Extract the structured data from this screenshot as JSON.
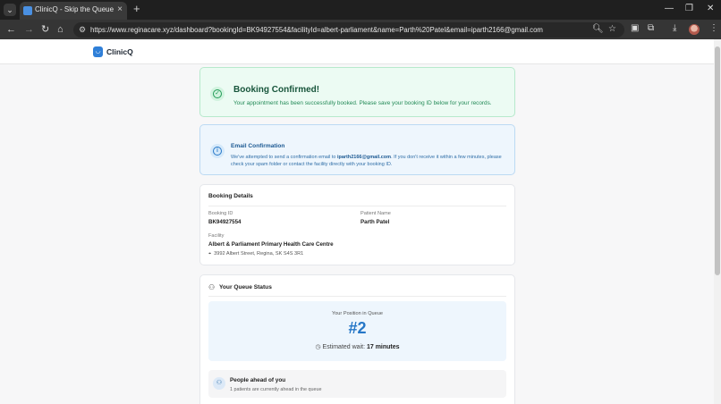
{
  "browser": {
    "tab_title": "ClinicQ - Skip the Queue",
    "url": "https://www.reginacare.xyz/dashboard?bookingId=BK94927554&facilityId=albert-parliament&name=Parth%20Patel&email=iparth2166@gmail.com"
  },
  "app": {
    "logo_text": "ClinicQ"
  },
  "confirmation": {
    "title": "Booking Confirmed!",
    "message": "Your appointment has been successfully booked. Please save your booking ID below for your records."
  },
  "email_notice": {
    "title": "Email Confirmation",
    "text_before": "We've attempted to send a confirmation email to ",
    "email": "iparth2166@gmail.com",
    "text_after": ". If you don't receive it within a few minutes, please check your spam folder or contact the facility directly with your booking ID."
  },
  "booking_details": {
    "heading": "Booking Details",
    "booking_id_label": "Booking ID",
    "booking_id": "BK94927554",
    "patient_name_label": "Patient Name",
    "patient_name": "Parth Patel",
    "facility_label": "Facility",
    "facility_name": "Albert & Parliament Primary Health Care Centre",
    "facility_address": "3992 Albert Street, Regina, SK S4S 3R1"
  },
  "queue_status": {
    "heading": "Your Queue Status",
    "position_label": "Your Position in Queue",
    "position": "#2",
    "wait_label": "Estimated wait: ",
    "wait_value": "17 minutes",
    "ahead_title": "People ahead of you",
    "ahead_text": "1 patients are currently ahead in the queue"
  }
}
